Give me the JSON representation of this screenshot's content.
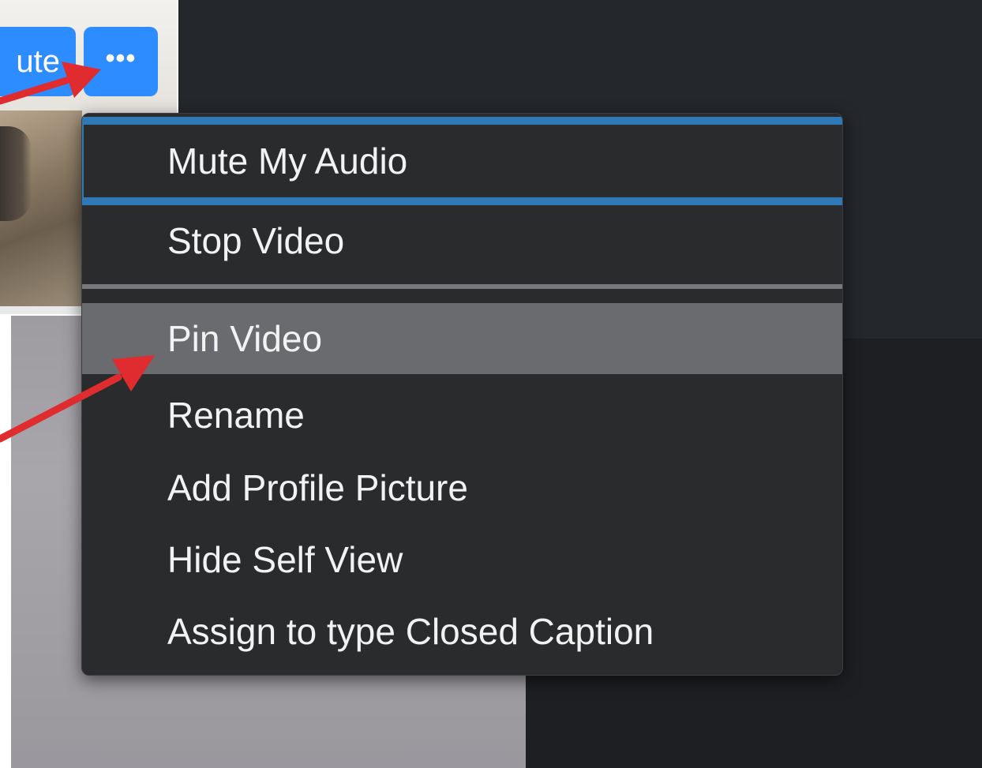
{
  "self_view": {
    "mute_button_label": "ute",
    "more_button_label": "•••"
  },
  "context_menu": {
    "items": [
      {
        "label": "Mute My Audio",
        "state": "focused"
      },
      {
        "label": "Stop Video",
        "state": "normal"
      },
      {
        "label": "Pin Video",
        "state": "highlighted"
      },
      {
        "label": "Rename",
        "state": "normal"
      },
      {
        "label": "Add Profile Picture",
        "state": "normal"
      },
      {
        "label": "Hide Self View",
        "state": "normal"
      },
      {
        "label": "Assign to type Closed Caption",
        "state": "normal"
      }
    ]
  },
  "colors": {
    "accent_blue": "#2d8cff",
    "focus_ring": "#2f79b7",
    "menu_background": "#2a2b2d",
    "highlight": "#6a6b6e",
    "annotation_arrow": "#e02b2f"
  },
  "annotations": [
    {
      "name": "arrow-to-more-button"
    },
    {
      "name": "arrow-to-pin-video"
    }
  ]
}
